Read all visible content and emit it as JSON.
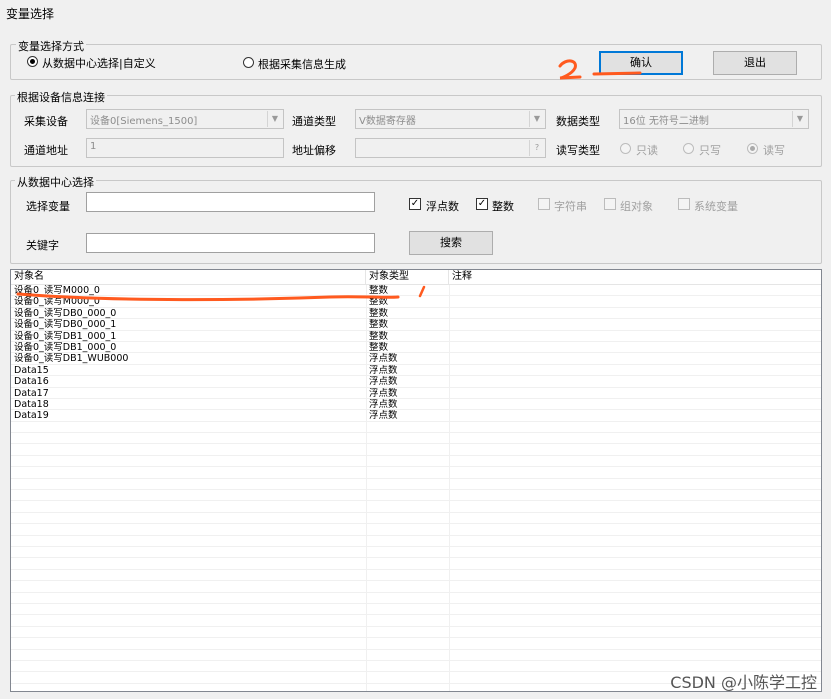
{
  "window": {
    "title": "变量选择"
  },
  "mode_group": {
    "label": "变量选择方式",
    "options": [
      {
        "label": "从数据中心选择|自定义",
        "selected": true
      },
      {
        "label": "根据采集信息生成",
        "selected": false
      }
    ],
    "confirm_label": "确认",
    "exit_label": "退出"
  },
  "device_group": {
    "label": "根据设备信息连接",
    "device_label": "采集设备",
    "device_value": "设备0[Siemens_1500]",
    "channel_type_label": "通道类型",
    "channel_type_value": "V数据寄存器",
    "data_type_label": "数据类型",
    "data_type_value": "16位 无符号二进制",
    "channel_addr_label": "通道地址",
    "channel_addr_value": "1",
    "addr_offset_label": "地址偏移",
    "addr_offset_value": "",
    "offset_btn": "?",
    "rw_type_label": "读写类型",
    "rw_options": [
      {
        "label": "只读",
        "selected": false
      },
      {
        "label": "只写",
        "selected": false
      },
      {
        "label": "读写",
        "selected": true
      }
    ]
  },
  "datacenter_group": {
    "label": "从数据中心选择",
    "select_var_label": "选择变量",
    "select_var_value": "",
    "filters": [
      {
        "label": "浮点数",
        "checked": true,
        "enabled": true
      },
      {
        "label": "整数",
        "checked": true,
        "enabled": true
      },
      {
        "label": "字符串",
        "checked": false,
        "enabled": false
      },
      {
        "label": "组对象",
        "checked": false,
        "enabled": false
      },
      {
        "label": "系统变量",
        "checked": false,
        "enabled": false
      }
    ],
    "keyword_label": "关键字",
    "keyword_value": "",
    "search_label": "搜索"
  },
  "list": {
    "columns": [
      "对象名",
      "对象类型",
      "注释"
    ],
    "rows": [
      [
        "设备0_读写M000_0",
        "整数",
        ""
      ],
      [
        "设备0_读写M000_0",
        "整数",
        ""
      ],
      [
        "设备0_读写DB0_000_0",
        "整数",
        ""
      ],
      [
        "设备0_读写DB0_000_1",
        "整数",
        ""
      ],
      [
        "设备0_读写DB1_000_1",
        "整数",
        ""
      ],
      [
        "设备0_读写DB1_000_0",
        "整数",
        ""
      ],
      [
        "设备0_读写DB1_WUB000",
        "浮点数",
        ""
      ],
      [
        "Data15",
        "浮点数",
        ""
      ],
      [
        "Data16",
        "浮点数",
        ""
      ],
      [
        "Data17",
        "浮点数",
        ""
      ],
      [
        "Data18",
        "浮点数",
        ""
      ],
      [
        "Data19",
        "浮点数",
        ""
      ]
    ]
  },
  "annotations": {
    "mark1": "1",
    "mark2": "2",
    "color": "#ff5a1f"
  },
  "watermark": "CSDN @小陈学工控"
}
